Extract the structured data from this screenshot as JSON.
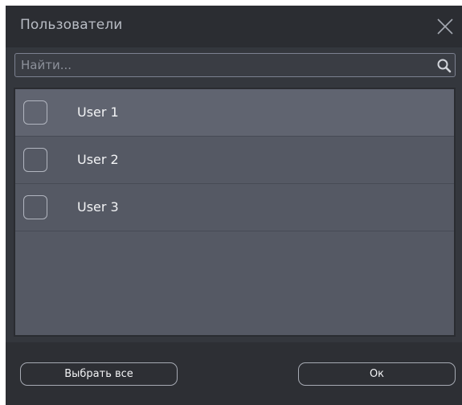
{
  "dialog": {
    "title": "Пользователи"
  },
  "search": {
    "placeholder": "Найти..."
  },
  "users": [
    {
      "label": "User 1",
      "checked": false
    },
    {
      "label": "User 2",
      "checked": false
    },
    {
      "label": "User 3",
      "checked": false
    }
  ],
  "footer": {
    "select_all_label": "Выбрать все",
    "ok_label": "Ок"
  },
  "icons": {
    "close": "close-icon",
    "search": "search-icon",
    "checkbox": "checkbox-icon"
  },
  "colors": {
    "background": "#34373d",
    "titlebar": "#2b2d32",
    "list_background": "#555964",
    "selected_row": "#606470",
    "text": "#f2f3f5"
  }
}
